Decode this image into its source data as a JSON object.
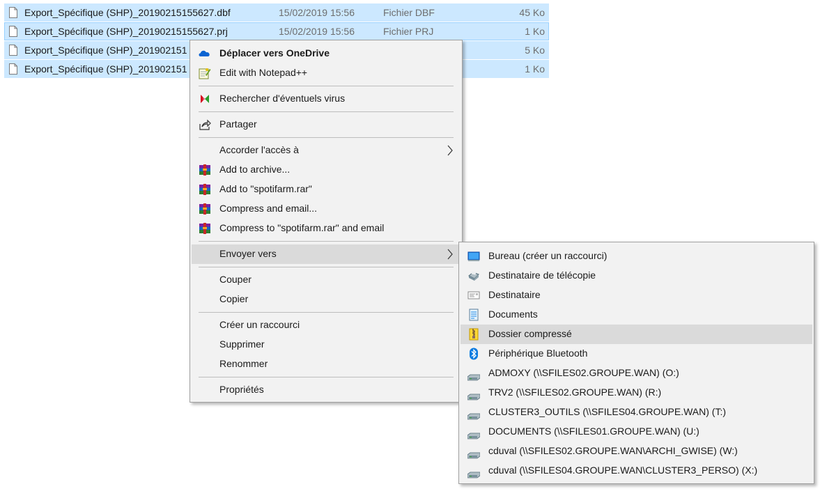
{
  "files": [
    {
      "name": "Export_Spécifique (SHP)_20190215155627.dbf",
      "date": "15/02/2019 15:56",
      "type": "Fichier DBF",
      "size": "45 Ko"
    },
    {
      "name": "Export_Spécifique (SHP)_20190215155627.prj",
      "date": "15/02/2019 15:56",
      "type": "Fichier PRJ",
      "size": "1 Ko"
    },
    {
      "name": "Export_Spécifique (SHP)_201902151",
      "date": "",
      "type": "",
      "size": "5 Ko"
    },
    {
      "name": "Export_Spécifique (SHP)_201902151",
      "date": "",
      "type": "",
      "size": "1 Ko"
    }
  ],
  "context_menu": {
    "move_onedrive": "Déplacer vers OneDrive",
    "edit_notepad": "Edit with Notepad++",
    "scan_virus": "Rechercher d'éventuels virus",
    "share": "Partager",
    "grant_access": "Accorder l'accès à",
    "add_archive": "Add to archive...",
    "add_rar": "Add to \"spotifarm.rar\"",
    "compress_email": "Compress and email...",
    "compress_rar_email": "Compress to \"spotifarm.rar\" and email",
    "send_to": "Envoyer vers",
    "cut": "Couper",
    "copy": "Copier",
    "create_shortcut": "Créer un raccourci",
    "delete": "Supprimer",
    "rename": "Renommer",
    "properties": "Propriétés"
  },
  "send_to_menu": {
    "desktop": "Bureau (créer un raccourci)",
    "fax": "Destinataire de télécopie",
    "mail": "Destinataire",
    "documents": "Documents",
    "zip": "Dossier compressé",
    "bluetooth": "Périphérique Bluetooth",
    "drives": [
      "ADMOXY (\\\\SFILES02.GROUPE.WAN) (O:)",
      "TRV2 (\\\\SFILES02.GROUPE.WAN) (R:)",
      "CLUSTER3_OUTILS (\\\\SFILES04.GROUPE.WAN) (T:)",
      "DOCUMENTS (\\\\SFILES01.GROUPE.WAN) (U:)",
      "cduval (\\\\SFILES02.GROUPE.WAN\\ARCHI_GWISE) (W:)",
      "cduval (\\\\SFILES04.GROUPE.WAN\\CLUSTER3_PERSO) (X:)"
    ]
  },
  "colors": {
    "selection": "#cce8ff",
    "menu_bg": "#f2f2f2",
    "menu_highlight": "#dadada",
    "onedrive": "#0a64d2",
    "bluetooth": "#0a7be0"
  }
}
